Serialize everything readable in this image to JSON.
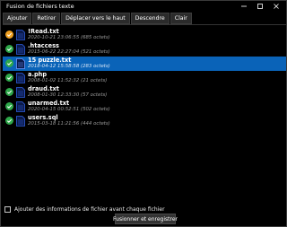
{
  "window": {
    "title": "Fusion de fichiers texte"
  },
  "toolbar": {
    "add": "Ajouter",
    "remove": "Retirer",
    "move_up": "Déplacer vers le haut",
    "move_down": "Descendre",
    "clear": "Clair"
  },
  "files": [
    {
      "name": "!Read.txt",
      "meta": "2020-10-21 23:06:55 (685 octets)",
      "status": "warning",
      "selected": false
    },
    {
      "name": ".htaccess",
      "meta": "2015-06-22 22:27:04 (521 octets)",
      "status": "ok",
      "selected": false
    },
    {
      "name": "15 puzzle.txt",
      "meta": "2018-04-12 15:58:58 (283 octets)",
      "status": "ok",
      "selected": true
    },
    {
      "name": "a.php",
      "meta": "2008-01-02 11:52:32 (21 octets)",
      "status": "ok",
      "selected": false
    },
    {
      "name": "draud.txt",
      "meta": "2008-01-30 12:33:30 (57 octets)",
      "status": "ok",
      "selected": false
    },
    {
      "name": "unarmed.txt",
      "meta": "2020-04-15 00:52:51 (502 octets)",
      "status": "ok",
      "selected": false
    },
    {
      "name": "users.sql",
      "meta": "2015-03-18 11:21:56 (444 octets)",
      "status": "ok",
      "selected": false
    }
  ],
  "options": {
    "add_info_label": "Ajouter des informations de fichier avant chaque fichier",
    "add_info_checked": false
  },
  "actions": {
    "merge_save": "Fusionner et enregistrer"
  },
  "colors": {
    "selection": "#0a63b8",
    "ok": "#2ea84a",
    "warning": "#f0a020",
    "doc": "#2f5fe0"
  }
}
